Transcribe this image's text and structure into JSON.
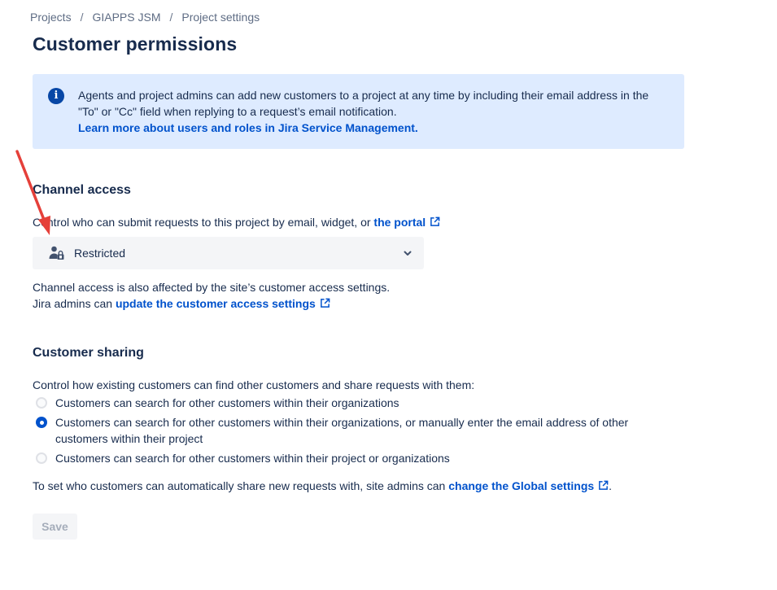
{
  "breadcrumb": {
    "items": [
      "Projects",
      "GIAPPS JSM",
      "Project settings"
    ],
    "separator": "/"
  },
  "page": {
    "title": "Customer permissions"
  },
  "info_panel": {
    "text_line1": "Agents and project admins can add new customers to a project at any time by including their email address in the",
    "text_line2": "\"To\" or \"Cc\" field when replying to a request’s email notification.",
    "link": "Learn more about users and roles in Jira Service Management.",
    "icon": "info-icon"
  },
  "channel_access": {
    "heading": "Channel access",
    "description": "Control who can submit requests to this project by email, widget, or ",
    "portal_link": "the portal",
    "select_value": "Restricted",
    "note_line1": "Channel access is also affected by the site’s customer access settings.",
    "note_line2_prefix": "Jira admins can ",
    "note_link": "update the customer access settings"
  },
  "customer_sharing": {
    "heading": "Customer sharing",
    "description": "Control how existing customers can find other customers and share requests with them:",
    "options": [
      {
        "label": "Customers can search for other customers within their organizations",
        "selected": false
      },
      {
        "label": "Customers can search for other customers within their organizations, or manually enter the email address of other customers within their project",
        "selected": true
      },
      {
        "label": "Customers can search for other customers within their project or organizations",
        "selected": false
      }
    ],
    "footer_prefix": "To set who customers can automatically share new requests with, site admins can ",
    "footer_link": "change the Global settings",
    "footer_suffix": "."
  },
  "actions": {
    "save_label": "Save"
  },
  "colors": {
    "accent": "#0052cc",
    "info_bg": "#deebff",
    "annotation_arrow": "#e5403a"
  }
}
